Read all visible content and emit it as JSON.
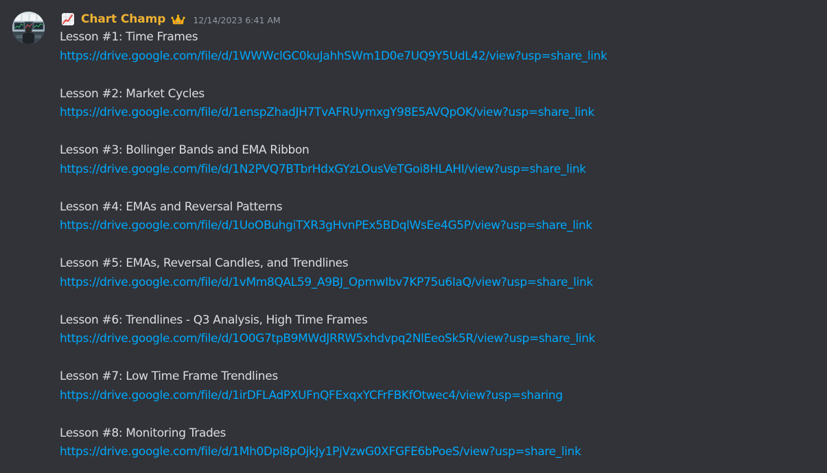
{
  "message": {
    "author": "Chart Champ",
    "timestamp": "12/14/2023 6:41 AM",
    "icons": {
      "role_icon": "chart-increasing-icon",
      "badge_icon": "crown-icon",
      "avatar": "avatar-trading-desk"
    },
    "colors": {
      "background": "#313338",
      "username": "#f0b232",
      "text": "#dbdee1",
      "link": "#00a8fc",
      "timestamp": "#949ba4"
    },
    "lessons": [
      {
        "title": "Lesson #1: Time Frames",
        "url": "https://drive.google.com/file/d/1WWWclGC0kuJahhSWm1D0e7UQ9Y5UdL42/view?usp=share_link"
      },
      {
        "title": "Lesson #2: Market Cycles",
        "url": "https://drive.google.com/file/d/1enspZhadJH7TvAFRUymxgY98E5AVQpOK/view?usp=share_link"
      },
      {
        "title": "Lesson #3: Bollinger Bands and EMA Ribbon",
        "url": "https://drive.google.com/file/d/1N2PVQ7BTbrHdxGYzLOusVeTGoi8HLAHI/view?usp=share_link"
      },
      {
        "title": "Lesson #4: EMAs and Reversal Patterns",
        "url": "https://drive.google.com/file/d/1UoOBuhgiTXR3gHvnPEx5BDqlWsEe4G5P/view?usp=share_link"
      },
      {
        "title": "Lesson #5: EMAs, Reversal Candles, and Trendlines",
        "url": "https://drive.google.com/file/d/1vMm8QAL59_A9BJ_OpmwIbv7KP75u6IaQ/view?usp=share_link"
      },
      {
        "title": "Lesson #6: Trendlines - Q3 Analysis, High Time Frames",
        "url": "https://drive.google.com/file/d/1O0G7tpB9MWdJRRW5xhdvpq2NlEeoSk5R/view?usp=share_link"
      },
      {
        "title": "Lesson #7: Low Time Frame Trendlines",
        "url": "https://drive.google.com/file/d/1irDFLAdPXUFnQFExqxYCFrFBKfOtwec4/view?usp=sharing"
      },
      {
        "title": "Lesson #8: Monitoring Trades",
        "url": "https://drive.google.com/file/d/1Mh0Dpl8pOjkJy1PjVzwG0XFGFE6bPoeS/view?usp=share_link"
      }
    ]
  }
}
